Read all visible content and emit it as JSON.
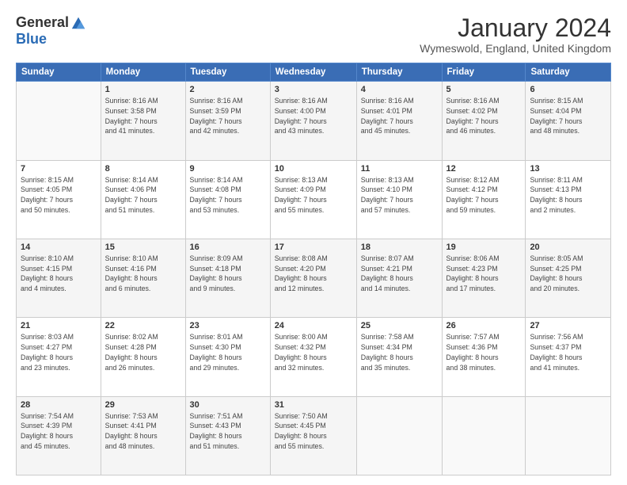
{
  "logo": {
    "general": "General",
    "blue": "Blue"
  },
  "title": "January 2024",
  "location": "Wymeswold, England, United Kingdom",
  "headers": [
    "Sunday",
    "Monday",
    "Tuesday",
    "Wednesday",
    "Thursday",
    "Friday",
    "Saturday"
  ],
  "weeks": [
    [
      {
        "day": "",
        "info": ""
      },
      {
        "day": "1",
        "info": "Sunrise: 8:16 AM\nSunset: 3:58 PM\nDaylight: 7 hours\nand 41 minutes."
      },
      {
        "day": "2",
        "info": "Sunrise: 8:16 AM\nSunset: 3:59 PM\nDaylight: 7 hours\nand 42 minutes."
      },
      {
        "day": "3",
        "info": "Sunrise: 8:16 AM\nSunset: 4:00 PM\nDaylight: 7 hours\nand 43 minutes."
      },
      {
        "day": "4",
        "info": "Sunrise: 8:16 AM\nSunset: 4:01 PM\nDaylight: 7 hours\nand 45 minutes."
      },
      {
        "day": "5",
        "info": "Sunrise: 8:16 AM\nSunset: 4:02 PM\nDaylight: 7 hours\nand 46 minutes."
      },
      {
        "day": "6",
        "info": "Sunrise: 8:15 AM\nSunset: 4:04 PM\nDaylight: 7 hours\nand 48 minutes."
      }
    ],
    [
      {
        "day": "7",
        "info": "Sunrise: 8:15 AM\nSunset: 4:05 PM\nDaylight: 7 hours\nand 50 minutes."
      },
      {
        "day": "8",
        "info": "Sunrise: 8:14 AM\nSunset: 4:06 PM\nDaylight: 7 hours\nand 51 minutes."
      },
      {
        "day": "9",
        "info": "Sunrise: 8:14 AM\nSunset: 4:08 PM\nDaylight: 7 hours\nand 53 minutes."
      },
      {
        "day": "10",
        "info": "Sunrise: 8:13 AM\nSunset: 4:09 PM\nDaylight: 7 hours\nand 55 minutes."
      },
      {
        "day": "11",
        "info": "Sunrise: 8:13 AM\nSunset: 4:10 PM\nDaylight: 7 hours\nand 57 minutes."
      },
      {
        "day": "12",
        "info": "Sunrise: 8:12 AM\nSunset: 4:12 PM\nDaylight: 7 hours\nand 59 minutes."
      },
      {
        "day": "13",
        "info": "Sunrise: 8:11 AM\nSunset: 4:13 PM\nDaylight: 8 hours\nand 2 minutes."
      }
    ],
    [
      {
        "day": "14",
        "info": "Sunrise: 8:10 AM\nSunset: 4:15 PM\nDaylight: 8 hours\nand 4 minutes."
      },
      {
        "day": "15",
        "info": "Sunrise: 8:10 AM\nSunset: 4:16 PM\nDaylight: 8 hours\nand 6 minutes."
      },
      {
        "day": "16",
        "info": "Sunrise: 8:09 AM\nSunset: 4:18 PM\nDaylight: 8 hours\nand 9 minutes."
      },
      {
        "day": "17",
        "info": "Sunrise: 8:08 AM\nSunset: 4:20 PM\nDaylight: 8 hours\nand 12 minutes."
      },
      {
        "day": "18",
        "info": "Sunrise: 8:07 AM\nSunset: 4:21 PM\nDaylight: 8 hours\nand 14 minutes."
      },
      {
        "day": "19",
        "info": "Sunrise: 8:06 AM\nSunset: 4:23 PM\nDaylight: 8 hours\nand 17 minutes."
      },
      {
        "day": "20",
        "info": "Sunrise: 8:05 AM\nSunset: 4:25 PM\nDaylight: 8 hours\nand 20 minutes."
      }
    ],
    [
      {
        "day": "21",
        "info": "Sunrise: 8:03 AM\nSunset: 4:27 PM\nDaylight: 8 hours\nand 23 minutes."
      },
      {
        "day": "22",
        "info": "Sunrise: 8:02 AM\nSunset: 4:28 PM\nDaylight: 8 hours\nand 26 minutes."
      },
      {
        "day": "23",
        "info": "Sunrise: 8:01 AM\nSunset: 4:30 PM\nDaylight: 8 hours\nand 29 minutes."
      },
      {
        "day": "24",
        "info": "Sunrise: 8:00 AM\nSunset: 4:32 PM\nDaylight: 8 hours\nand 32 minutes."
      },
      {
        "day": "25",
        "info": "Sunrise: 7:58 AM\nSunset: 4:34 PM\nDaylight: 8 hours\nand 35 minutes."
      },
      {
        "day": "26",
        "info": "Sunrise: 7:57 AM\nSunset: 4:36 PM\nDaylight: 8 hours\nand 38 minutes."
      },
      {
        "day": "27",
        "info": "Sunrise: 7:56 AM\nSunset: 4:37 PM\nDaylight: 8 hours\nand 41 minutes."
      }
    ],
    [
      {
        "day": "28",
        "info": "Sunrise: 7:54 AM\nSunset: 4:39 PM\nDaylight: 8 hours\nand 45 minutes."
      },
      {
        "day": "29",
        "info": "Sunrise: 7:53 AM\nSunset: 4:41 PM\nDaylight: 8 hours\nand 48 minutes."
      },
      {
        "day": "30",
        "info": "Sunrise: 7:51 AM\nSunset: 4:43 PM\nDaylight: 8 hours\nand 51 minutes."
      },
      {
        "day": "31",
        "info": "Sunrise: 7:50 AM\nSunset: 4:45 PM\nDaylight: 8 hours\nand 55 minutes."
      },
      {
        "day": "",
        "info": ""
      },
      {
        "day": "",
        "info": ""
      },
      {
        "day": "",
        "info": ""
      }
    ]
  ]
}
